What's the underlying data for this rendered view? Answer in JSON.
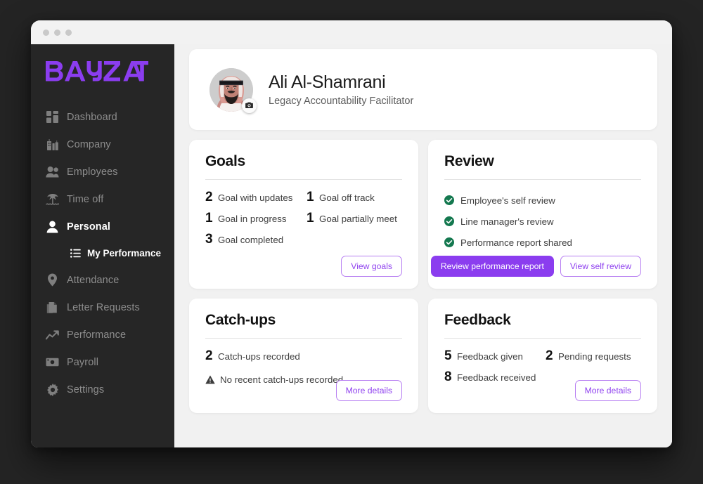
{
  "window": {
    "traffic_dots": 3
  },
  "brand": {
    "name": "BAYZAT",
    "accent": "#8b3def",
    "sidebar_bg": "#262626"
  },
  "sidebar": {
    "items": [
      {
        "label": "Dashboard",
        "icon": "dashboard-grid-icon",
        "active": false
      },
      {
        "label": "Company",
        "icon": "buildings-icon",
        "active": false
      },
      {
        "label": "Employees",
        "icon": "people-icon",
        "active": false
      },
      {
        "label": "Time off",
        "icon": "palm-tree-icon",
        "active": false
      },
      {
        "label": "Personal",
        "icon": "person-icon",
        "active": true
      },
      {
        "label": "Attendance",
        "icon": "location-pin-icon",
        "active": false
      },
      {
        "label": "Letter Requests",
        "icon": "documents-icon",
        "active": false
      },
      {
        "label": "Performance",
        "icon": "trend-arrow-icon",
        "active": false
      },
      {
        "label": "Payroll",
        "icon": "banknote-icon",
        "active": false
      },
      {
        "label": "Settings",
        "icon": "gear-icon",
        "active": false
      }
    ],
    "sub_item": {
      "label": "My Performance",
      "icon": "list-icon"
    }
  },
  "profile": {
    "name": "Ali Al-Shamrani",
    "job_title": "Legacy Accountability Facilitator",
    "avatar_alt": "employee-photo",
    "camera_badge_icon": "camera-icon"
  },
  "cards": {
    "goals": {
      "title": "Goals",
      "stats_left": [
        {
          "count": "2",
          "label": "Goal with updates"
        },
        {
          "count": "1",
          "label": "Goal in progress"
        },
        {
          "count": "3",
          "label": "Goal completed"
        }
      ],
      "stats_right": [
        {
          "count": "1",
          "label": "Goal off track"
        },
        {
          "count": "1",
          "label": "Goal partially meet"
        }
      ],
      "button": "View goals"
    },
    "review": {
      "title": "Review",
      "checklist": [
        "Employee's self review",
        "Line manager's review",
        "Performance report shared"
      ],
      "primary_button": "Review performance report",
      "secondary_button": "View self review"
    },
    "catchups": {
      "title": "Catch-ups",
      "stat": {
        "count": "2",
        "label": "Catch-ups recorded"
      },
      "warning": "No recent catch-ups recorded",
      "button": "More details"
    },
    "feedback": {
      "title": "Feedback",
      "stats_left": [
        {
          "count": "5",
          "label": "Feedback given"
        },
        {
          "count": "8",
          "label": "Feedback received"
        }
      ],
      "stats_right": [
        {
          "count": "2",
          "label": "Pending requests"
        }
      ],
      "button": "More details"
    }
  }
}
